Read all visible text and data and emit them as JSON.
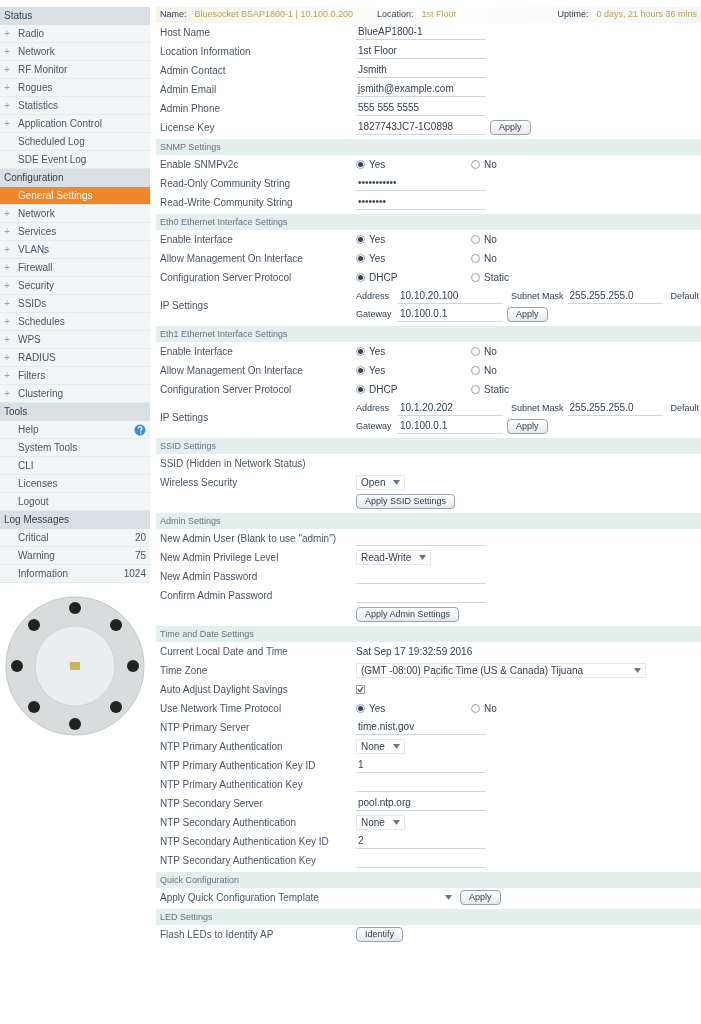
{
  "top_bar": {
    "name_label": "Name:",
    "name_value": "Bluesocket BSAP1800-1 | 10.100.0.200",
    "location_label": "Location:",
    "location_value": "1st Floor",
    "uptime_label": "Uptime:",
    "uptime_value": "0 days, 21 hours 36 mins"
  },
  "sidebar": {
    "groups": [
      {
        "title": "Status",
        "items": [
          {
            "marker": "+",
            "label": "Radio",
            "selected": false
          },
          {
            "marker": "+",
            "label": "Network",
            "selected": false
          },
          {
            "marker": "+",
            "label": "RF Monitor",
            "selected": false
          },
          {
            "marker": "+",
            "label": "Rogues",
            "selected": false
          },
          {
            "marker": "+",
            "label": "Statistics",
            "selected": false
          },
          {
            "marker": "+",
            "label": "Application Control",
            "selected": false
          },
          {
            "label": "Scheduled Log",
            "selected": false
          },
          {
            "label": "SDE Event Log",
            "selected": false
          }
        ]
      },
      {
        "title": "Configuration",
        "items": [
          {
            "label": "General Settings",
            "selected": true
          },
          {
            "marker": "+",
            "label": "Network",
            "selected": false
          },
          {
            "marker": "+",
            "label": "Services",
            "selected": false
          },
          {
            "marker": "+",
            "label": "VLANs",
            "selected": false
          },
          {
            "marker": "+",
            "label": "Firewall",
            "selected": false
          },
          {
            "marker": "+",
            "label": "Security",
            "selected": false
          },
          {
            "marker": "+",
            "label": "SSIDs",
            "selected": false
          },
          {
            "marker": "+",
            "label": "Schedules",
            "selected": false
          },
          {
            "marker": "+",
            "label": "WPS",
            "selected": false
          },
          {
            "marker": "+",
            "label": "RADIUS",
            "selected": false
          },
          {
            "marker": "+",
            "label": "Filters",
            "selected": false
          },
          {
            "marker": "+",
            "label": "Clustering",
            "selected": false
          }
        ]
      },
      {
        "title": "Tools",
        "items": [
          {
            "label": "Help",
            "selected": false,
            "help_icon": true
          },
          {
            "label": "System Tools",
            "selected": false
          },
          {
            "label": "CLI",
            "selected": false
          },
          {
            "label": "Licenses",
            "selected": false
          },
          {
            "label": "Logout",
            "selected": false
          }
        ]
      },
      {
        "title": "Log Messages",
        "items": [
          {
            "label": "Critical",
            "count": "20",
            "selected": false
          },
          {
            "label": "Warning",
            "count": "75",
            "selected": false
          },
          {
            "label": "Information",
            "count": "1024",
            "selected": false
          }
        ]
      }
    ]
  },
  "sections": [
    {
      "rows": [
        {
          "kind": "field",
          "label": "Host Name",
          "value": "BlueAP1800-1"
        },
        {
          "kind": "field",
          "label": "Location Information",
          "value": "1st Floor"
        },
        {
          "kind": "field",
          "label": "Admin Contact",
          "value": "Jsmith"
        },
        {
          "kind": "field",
          "label": "Admin Email",
          "value": "jsmith@example.com"
        },
        {
          "kind": "field",
          "label": "Admin Phone",
          "value": "555 555 5555"
        },
        {
          "kind": "field_button",
          "label": "License Key",
          "value": "1827743JC7-1C0898",
          "button": "Apply"
        }
      ]
    },
    {
      "title": "SNMP Settings",
      "rows": [
        {
          "kind": "radio",
          "label": "Enable SNMPv2c",
          "options": [
            {
              "label": "Yes",
              "selected": true
            },
            {
              "label": "No",
              "selected": false
            }
          ]
        },
        {
          "kind": "field",
          "label": "Read-Only Community String",
          "value": "•••••••••••"
        },
        {
          "kind": "field",
          "label": "Read-Write Community String",
          "value": "••••••••"
        }
      ]
    },
    {
      "title": "Eth0 Ethernet Interface Settings",
      "rows": [
        {
          "kind": "radio",
          "label": "Enable Interface",
          "options": [
            {
              "label": "Yes",
              "selected": true
            },
            {
              "label": "No",
              "selected": false
            }
          ]
        },
        {
          "kind": "radio",
          "label": "Allow Management On Interface",
          "options": [
            {
              "label": "Yes",
              "selected": true
            },
            {
              "label": "No",
              "selected": false
            }
          ]
        },
        {
          "kind": "radio",
          "label": "Configuration Server Protocol",
          "options": [
            {
              "label": "DHCP",
              "selected": true
            },
            {
              "label": "Static",
              "selected": false
            }
          ]
        },
        {
          "kind": "ip",
          "label": "IP Settings",
          "address_label": "Address",
          "address": "10.10.20.100",
          "mask_label": "Subnet Mask",
          "mask": "255.255.255.0",
          "default_label": "Default",
          "gateway_label": "Gateway",
          "gateway": "10.100.0.1",
          "button": "Apply"
        }
      ]
    },
    {
      "title": "Eth1 Ethernet Interface Settings",
      "rows": [
        {
          "kind": "radio",
          "label": "Enable Interface",
          "options": [
            {
              "label": "Yes",
              "selected": true
            },
            {
              "label": "No",
              "selected": false
            }
          ]
        },
        {
          "kind": "radio",
          "label": "Allow Management On Interface",
          "options": [
            {
              "label": "Yes",
              "selected": true
            },
            {
              "label": "No",
              "selected": false
            }
          ]
        },
        {
          "kind": "radio",
          "label": "Configuration Server Protocol",
          "options": [
            {
              "label": "DHCP",
              "selected": true
            },
            {
              "label": "Static",
              "selected": false
            }
          ]
        },
        {
          "kind": "ip",
          "label": "IP Settings",
          "address_label": "Address",
          "address": "10.1.20.202",
          "mask_label": "Subnet Mask",
          "mask": "255.255.255.0",
          "default_label": "Default",
          "gateway_label": "Gateway",
          "gateway": "10.100.0.1",
          "button": "Apply"
        }
      ]
    },
    {
      "title": "SSID Settings",
      "rows": [
        {
          "kind": "label_only",
          "label": "SSID (Hidden in Network Status)"
        },
        {
          "kind": "select",
          "label": "Wireless Security",
          "value": "Open"
        },
        {
          "kind": "button",
          "button": "Apply SSID Settings"
        }
      ]
    },
    {
      "title": "Admin Settings",
      "rows": [
        {
          "kind": "field",
          "label": "New Admin User (Blank to use \"admin\")"
        },
        {
          "kind": "select",
          "label": "New Admin Privilege Level",
          "value": "Read-Write"
        },
        {
          "kind": "field",
          "label": "New Admin Password"
        },
        {
          "kind": "field",
          "label": "Confirm Admin Password"
        },
        {
          "kind": "button",
          "button": "Apply Admin Settings"
        }
      ]
    },
    {
      "title": "Time and Date Settings",
      "rows": [
        {
          "kind": "plain",
          "label": "Current Local Date and Time",
          "value": "Sat Sep 17 19:32:59 2016"
        },
        {
          "kind": "select",
          "label": "Time Zone",
          "value": "(GMT -08:00) Pacific Time (US & Canada) Tijuana",
          "wide": true
        },
        {
          "kind": "checkbox",
          "label": "Auto Adjust Daylight Savings",
          "checked": true
        },
        {
          "kind": "radio",
          "label": "Use Network Time Protocol",
          "options": [
            {
              "label": "Yes",
              "selected": true
            },
            {
              "label": "No",
              "selected": false
            }
          ]
        },
        {
          "kind": "field",
          "label": "NTP Primary Server",
          "value": "time.nist.gov"
        },
        {
          "kind": "select",
          "label": "NTP Primary Authentication",
          "value": "None"
        },
        {
          "kind": "field",
          "label": "NTP Primary Authentication Key ID",
          "value": "1"
        },
        {
          "kind": "field",
          "label": "NTP Primary Authentication Key"
        },
        {
          "kind": "field",
          "label": "NTP Secondary Server",
          "value": "pool.ntp.org"
        },
        {
          "kind": "select",
          "label": "NTP Secondary Authentication",
          "value": "None"
        },
        {
          "kind": "field",
          "label": "NTP Secondary Authentication Key ID",
          "value": "2"
        },
        {
          "kind": "field",
          "label": "NTP Secondary Authentication Key"
        }
      ]
    },
    {
      "title": "Quick Configuration",
      "rows": [
        {
          "kind": "select_button",
          "label": "Apply Quick Configuration Template",
          "button": "Apply"
        }
      ]
    },
    {
      "title": "LED Settings",
      "rows": [
        {
          "kind": "button",
          "label": "Flash LEDs to Identify AP",
          "button": "Identify"
        }
      ]
    }
  ]
}
